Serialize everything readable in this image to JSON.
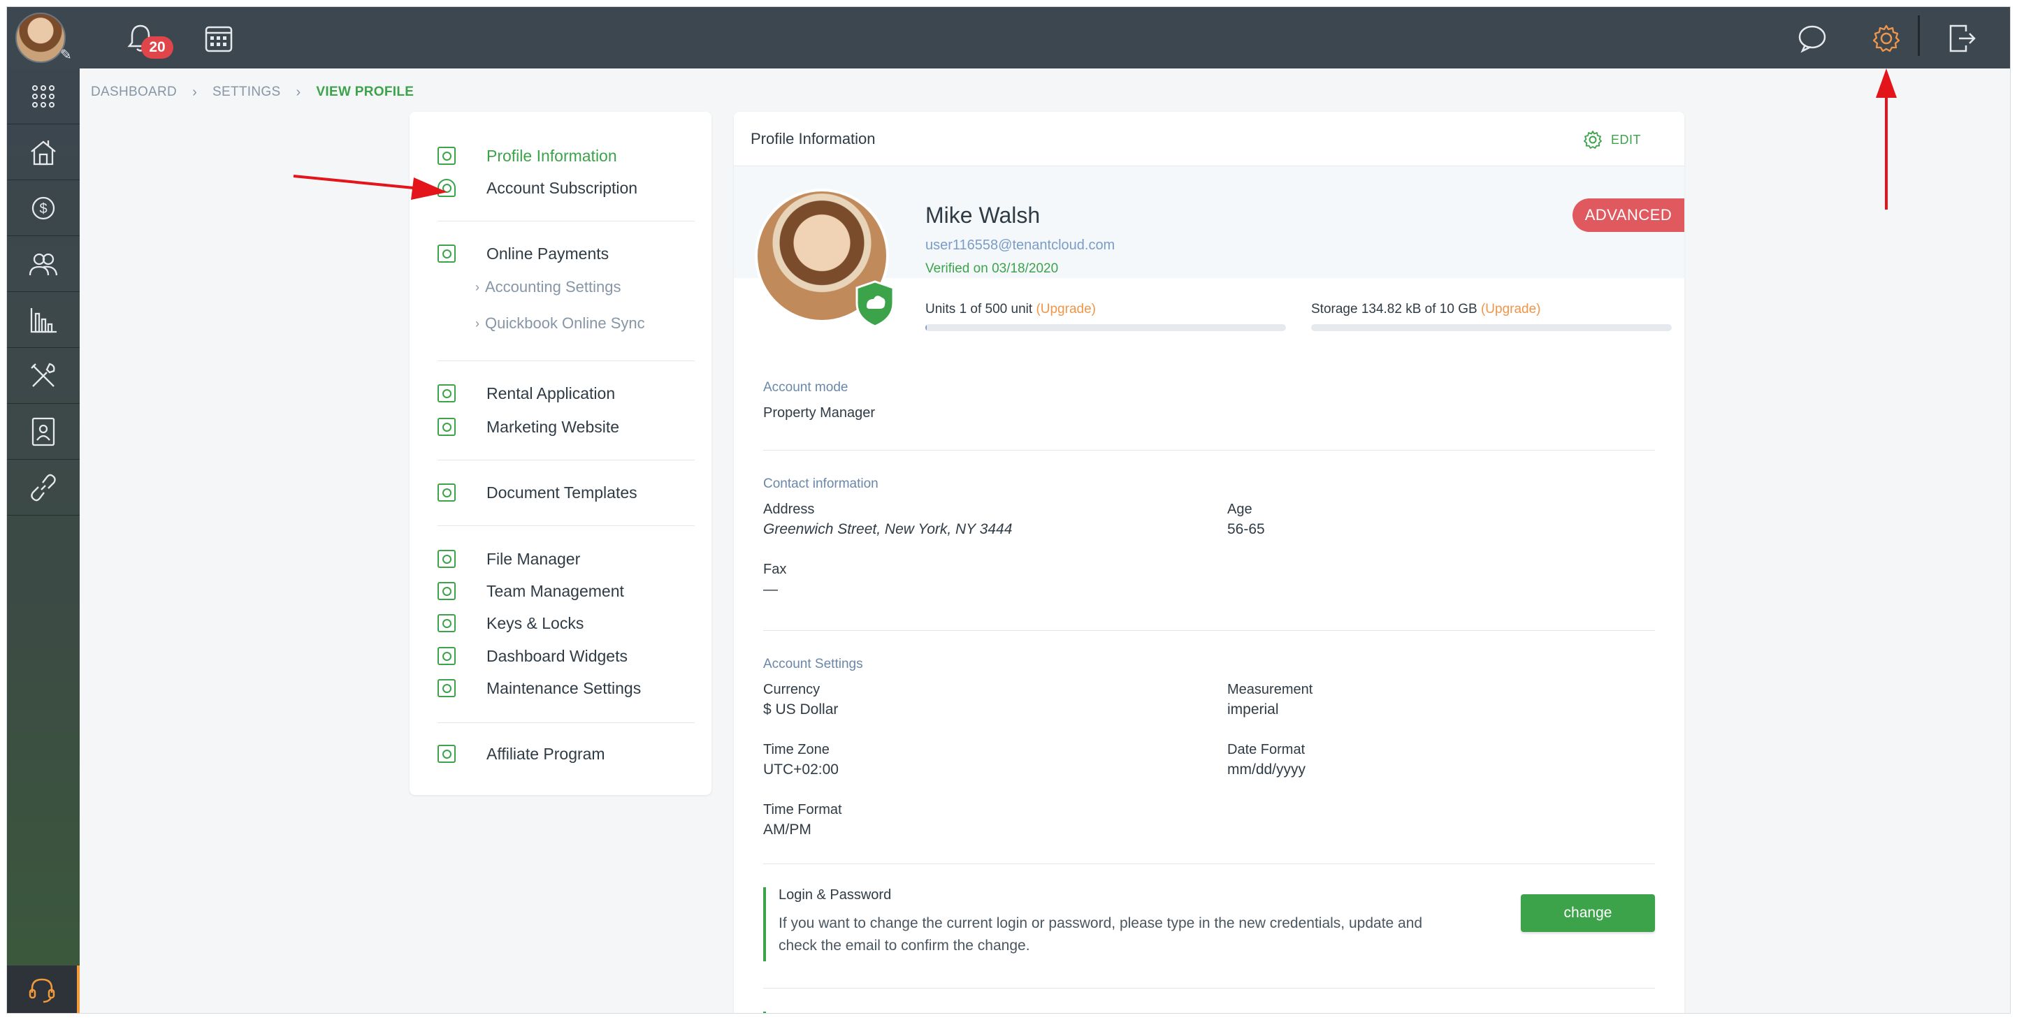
{
  "topbar": {
    "notification_count": "20"
  },
  "breadcrumb": [
    "Dashboard",
    "Settings",
    "View Profile"
  ],
  "settings_menu": {
    "profile_information": "Profile Information",
    "account_subscription": "Account Subscription",
    "online_payments": "Online Payments",
    "accounting_settings": "Accounting Settings",
    "quickbook_online_sync": "Quickbook Online Sync",
    "rental_application": "Rental Application",
    "marketing_website": "Marketing Website",
    "document_templates": "Document Templates",
    "file_manager": "File Manager",
    "team_management": "Team Management",
    "keys_locks": "Keys & Locks",
    "dashboard_widgets": "Dashboard Widgets",
    "maintenance_settings": "Maintenance Settings",
    "affiliate_program": "Affiliate Program"
  },
  "profile": {
    "card_title": "Profile Information",
    "edit_label": "EDIT",
    "name": "Mike Walsh",
    "email": "user116558@tenantcloud.com",
    "verified_on": "Verified on 03/18/2020",
    "plan_badge": "ADVANCED",
    "units_usage": "Units 1 of 500 unit",
    "units_fill": 0.002,
    "storage_usage": "Storage 134.82 kB of 10 GB",
    "storage_fill": 0.0,
    "upgrade_label": "(Upgrade)"
  },
  "account_mode": {
    "section_label": "Account mode",
    "value": "Property Manager"
  },
  "contact": {
    "section_label": "Contact information",
    "address_label": "Address",
    "address_value": "Greenwich Street, New York, NY 3444",
    "age_label": "Age",
    "age_value": "56-65",
    "fax_label": "Fax",
    "fax_value": "—"
  },
  "account_settings": {
    "section_label": "Account Settings",
    "currency_label": "Currency",
    "currency_value": "$ US Dollar",
    "measurement_label": "Measurement",
    "measurement_value": "imperial",
    "timezone_label": "Time Zone",
    "timezone_value": "UTC+02:00",
    "date_format_label": "Date Format",
    "date_format_value": "mm/dd/yyyy",
    "time_format_label": "Time Format",
    "time_format_value": "AM/PM"
  },
  "login": {
    "title": "Login & Password",
    "text": "If you want to change the current login or password, please type in the new credentials, update and check the email to confirm the change.",
    "button": "change"
  },
  "colors": {
    "accent_green": "#3ca34a",
    "plan_badge": "#e0595e",
    "settings_icon_active": "#f0964a",
    "annotation_arrow": "#e3141a"
  }
}
